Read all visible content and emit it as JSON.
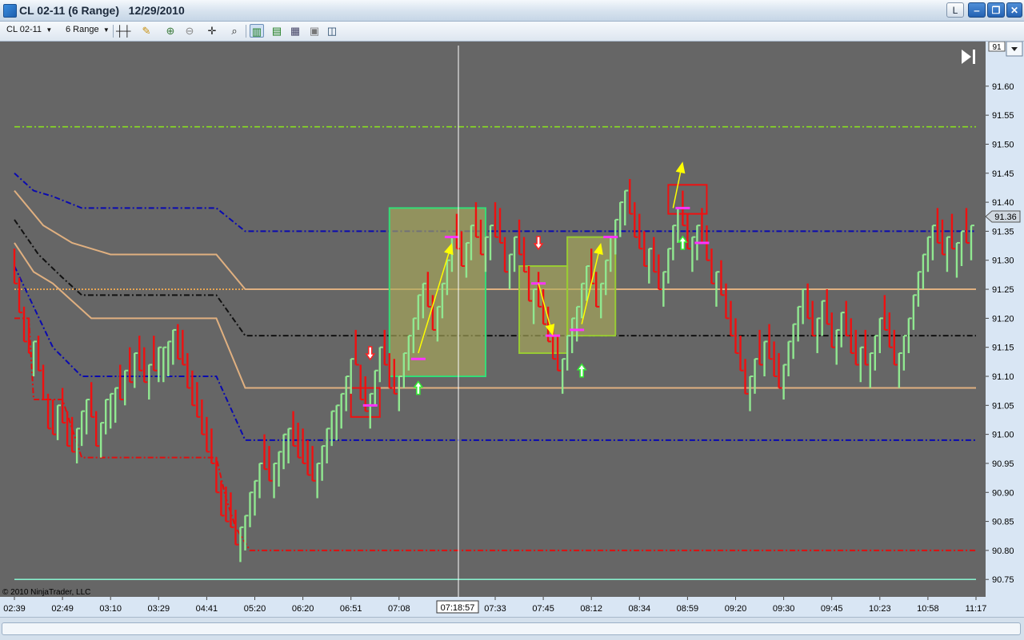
{
  "window": {
    "title": "CL 02-11 (6 Range)   12/29/2010",
    "buttons": {
      "l": "L",
      "minimize": "‒",
      "restore": "❐",
      "close": "✕"
    }
  },
  "toolbar": {
    "instrument": "CL 02-11",
    "period": "6 Range",
    "icons": [
      "bar-style-icon",
      "draw-pencil-icon",
      "zoom-in-icon",
      "zoom-out-icon",
      "crosshair-icon",
      "search-icon",
      "bars-icon",
      "candles-icon",
      "chart-properties-icon",
      "data-box-icon",
      "layout-icon"
    ]
  },
  "chart": {
    "copyright": "© 2010 NinjaTrader, LLC",
    "colors": {
      "background": "#666666",
      "up_bar": "#90e890",
      "down_bar": "#f01010",
      "marker": "#ff33ff",
      "arrow": "#ffff00"
    },
    "price_badge": "91.36",
    "top_badge": "91",
    "crosshair_label": "07:18:57",
    "goto_end_icon": "goto-end-icon"
  },
  "chart_data": {
    "type": "bar",
    "ylim": [
      90.72,
      91.67
    ],
    "y_ticks": [
      "91.60",
      "91.55",
      "91.50",
      "91.45",
      "91.40",
      "91.35",
      "91.30",
      "91.25",
      "91.20",
      "91.15",
      "91.10",
      "91.05",
      "91.00",
      "90.95",
      "90.90",
      "90.85",
      "90.80",
      "90.75"
    ],
    "x_ticks": [
      {
        "label": "02:39",
        "i": 0
      },
      {
        "label": "02:49",
        "i": 10
      },
      {
        "label": "03:10",
        "i": 20
      },
      {
        "label": "03:29",
        "i": 30
      },
      {
        "label": "04:41",
        "i": 40
      },
      {
        "label": "05:20",
        "i": 50
      },
      {
        "label": "06:20",
        "i": 60
      },
      {
        "label": "06:51",
        "i": 70
      },
      {
        "label": "07:08",
        "i": 80
      },
      {
        "label": "07:33",
        "i": 100
      },
      {
        "label": "07:45",
        "i": 110
      },
      {
        "label": "08:12",
        "i": 120
      },
      {
        "label": "08:34",
        "i": 130
      },
      {
        "label": "08:59",
        "i": 140
      },
      {
        "label": "09:20",
        "i": 150
      },
      {
        "label": "09:30",
        "i": 160
      },
      {
        "label": "09:45",
        "i": 170
      },
      {
        "label": "10:23",
        "i": 180
      },
      {
        "label": "10:58",
        "i": 190
      },
      {
        "label": "11:17",
        "i": 200
      }
    ],
    "bar_count": 201,
    "bar_closes": [
      91.26,
      91.21,
      91.16,
      91.14,
      91.16,
      91.11,
      91.06,
      91.01,
      91.0,
      91.05,
      91.02,
      90.98,
      90.97,
      91.01,
      91.04,
      91.06,
      91.03,
      90.98,
      91.02,
      91.06,
      91.07,
      91.08,
      91.06,
      91.11,
      91.09,
      91.14,
      91.11,
      91.09,
      91.12,
      91.11,
      91.15,
      91.15,
      91.16,
      91.18,
      91.13,
      91.12,
      91.08,
      91.05,
      91.03,
      91.0,
      90.97,
      90.95,
      90.9,
      90.86,
      90.85,
      90.84,
      90.81,
      90.84,
      90.86,
      90.9,
      90.92,
      90.95,
      90.94,
      90.92,
      90.95,
      90.97,
      91.0,
      91.01,
      90.98,
      90.96,
      90.95,
      90.93,
      90.92,
      90.95,
      90.98,
      91.01,
      91.04,
      91.05,
      91.07,
      91.1,
      91.13,
      91.12,
      91.06,
      91.04,
      91.07,
      91.11,
      91.15,
      91.12,
      91.08,
      91.07,
      91.1,
      91.14,
      91.17,
      91.2,
      91.24,
      91.26,
      91.22,
      91.18,
      91.22,
      91.26,
      91.3,
      91.34,
      91.32,
      91.29,
      91.33,
      91.36,
      91.34,
      91.31,
      91.34,
      91.36,
      91.34,
      91.33,
      91.28,
      91.31,
      91.34,
      91.31,
      91.28,
      91.23,
      91.25,
      91.22,
      91.19,
      91.16,
      91.13,
      91.11,
      91.13,
      91.17,
      91.2,
      91.22,
      91.26,
      91.29,
      91.26,
      91.22,
      91.26,
      91.3,
      91.34,
      91.37,
      91.4,
      91.42,
      91.38,
      91.34,
      91.32,
      91.29,
      91.32,
      91.28,
      91.25,
      91.28,
      91.32,
      91.36,
      91.39,
      91.36,
      91.32,
      91.34,
      91.36,
      91.33,
      91.3,
      91.26,
      91.28,
      91.24,
      91.2,
      91.17,
      91.14,
      91.11,
      91.07,
      91.1,
      91.13,
      91.12,
      91.16,
      91.13,
      91.1,
      91.08,
      91.12,
      91.16,
      91.19,
      91.22,
      91.25,
      91.2,
      91.17,
      91.2,
      91.23,
      91.19,
      91.15,
      91.18,
      91.21,
      91.17,
      91.14,
      91.12,
      91.15,
      91.12,
      91.14,
      91.17,
      91.2,
      91.18,
      91.15,
      91.12,
      91.14,
      91.17,
      91.2,
      91.24,
      91.28,
      91.31,
      91.34,
      91.36,
      91.33,
      91.31,
      91.34,
      91.32,
      91.33,
      91.35,
      91.33,
      91.36
    ],
    "levels": [
      {
        "value": 91.53,
        "color": "#88dd22",
        "style": "dashdot"
      },
      {
        "value": 91.25,
        "color": "#ffb050",
        "style": "dotted"
      },
      {
        "value": 90.75,
        "color": "#88eecc",
        "style": "solid"
      }
    ],
    "bands": [
      {
        "color": "#0a0ab0",
        "style": "dashdot",
        "points": [
          [
            0,
            91.45
          ],
          [
            4,
            91.42
          ],
          [
            8,
            91.41
          ],
          [
            14,
            91.39
          ],
          [
            42,
            91.39
          ],
          [
            48,
            91.35
          ],
          [
            200,
            91.35
          ]
        ]
      },
      {
        "color": "#e0b080",
        "style": "solid",
        "points": [
          [
            0,
            91.42
          ],
          [
            6,
            91.36
          ],
          [
            12,
            91.33
          ],
          [
            20,
            91.31
          ],
          [
            42,
            91.31
          ],
          [
            48,
            91.25
          ],
          [
            200,
            91.25
          ]
        ]
      },
      {
        "color": "#111111",
        "style": "dashdot",
        "points": [
          [
            0,
            91.37
          ],
          [
            5,
            91.31
          ],
          [
            10,
            91.27
          ],
          [
            14,
            91.24
          ],
          [
            42,
            91.24
          ],
          [
            48,
            91.17
          ],
          [
            200,
            91.17
          ]
        ]
      },
      {
        "color": "#e0b080",
        "style": "solid",
        "points": [
          [
            0,
            91.33
          ],
          [
            4,
            91.28
          ],
          [
            8,
            91.26
          ],
          [
            12,
            91.23
          ],
          [
            16,
            91.2
          ],
          [
            42,
            91.2
          ],
          [
            48,
            91.08
          ],
          [
            200,
            91.08
          ]
        ]
      },
      {
        "color": "#0a0ab0",
        "style": "dashdot",
        "points": [
          [
            0,
            91.29
          ],
          [
            4,
            91.22
          ],
          [
            8,
            91.15
          ],
          [
            14,
            91.1
          ],
          [
            42,
            91.1
          ],
          [
            48,
            90.99
          ],
          [
            200,
            90.99
          ]
        ]
      },
      {
        "color": "#e01010",
        "style": "dashdot",
        "points": [
          [
            0,
            91.2
          ],
          [
            3,
            91.2
          ],
          [
            4,
            91.06
          ],
          [
            10,
            91.06
          ],
          [
            14,
            90.96
          ],
          [
            42,
            90.96
          ],
          [
            44,
            90.89
          ],
          [
            46,
            90.84
          ],
          [
            49,
            90.8
          ],
          [
            200,
            90.8
          ]
        ]
      }
    ],
    "boxes": [
      {
        "i0": 78,
        "i1": 98,
        "top": 91.39,
        "bottom": 91.1,
        "stroke": "#33dd77",
        "fill": "rgba(170,170,90,0.65)"
      },
      {
        "i0": 105,
        "i1": 115,
        "top": 91.29,
        "bottom": 91.14,
        "stroke": "#99cc33",
        "fill": "rgba(170,170,90,0.65)"
      },
      {
        "i0": 115,
        "i1": 125,
        "top": 91.34,
        "bottom": 91.17,
        "stroke": "#99cc33",
        "fill": "rgba(170,170,90,0.65)"
      },
      {
        "i0": 70,
        "i1": 76,
        "top": 91.08,
        "bottom": 91.03,
        "stroke": "#ee1111",
        "fill": "none"
      },
      {
        "i0": 136,
        "i1": 144,
        "top": 91.43,
        "bottom": 91.38,
        "stroke": "#ee1111",
        "fill": "none"
      }
    ],
    "markers": [
      [
        74,
        91.05
      ],
      [
        84,
        91.13
      ],
      [
        91,
        91.34
      ],
      [
        109,
        91.26
      ],
      [
        112,
        91.17
      ],
      [
        117,
        91.18
      ],
      [
        124,
        91.34
      ],
      [
        139,
        91.39
      ],
      [
        143,
        91.33
      ]
    ],
    "signal_arrows": [
      {
        "i": 74,
        "price": 91.14,
        "dir": "down",
        "color": "#ff2222"
      },
      {
        "i": 84,
        "price": 91.08,
        "dir": "up",
        "color": "#33ee33"
      },
      {
        "i": 109,
        "price": 91.33,
        "dir": "down",
        "color": "#ff2222"
      },
      {
        "i": 118,
        "price": 91.11,
        "dir": "up",
        "color": "#33ee33"
      },
      {
        "i": 139,
        "price": 91.33,
        "dir": "up",
        "color": "#33ee33"
      }
    ],
    "trend_arrows": [
      [
        84,
        91.14,
        91,
        91.33
      ],
      [
        109,
        91.26,
        112,
        91.17
      ],
      [
        118,
        91.19,
        122,
        91.33
      ],
      [
        137,
        91.39,
        139,
        91.47
      ]
    ]
  }
}
